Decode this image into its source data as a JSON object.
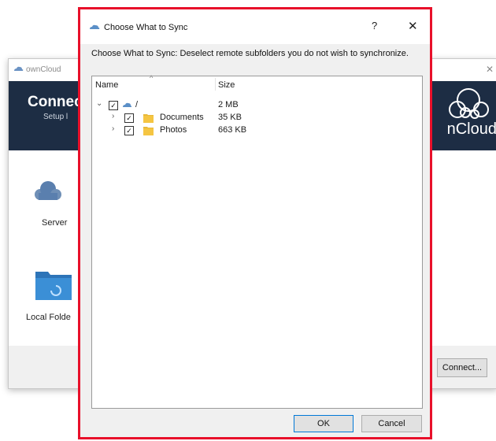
{
  "background_window": {
    "title": "ownCloud",
    "header_title": "Connec",
    "header_subtitle": "Setup l",
    "logo_text": "nCloud",
    "server_label": "Server",
    "local_folder_label": "Local Folde",
    "connect_button": "Connect..."
  },
  "dialog": {
    "title": "Choose What to Sync",
    "help_label": "?",
    "close_label": "✕",
    "description": "Choose What to Sync: Deselect remote subfolders you do not wish to synchronize.",
    "columns": {
      "name": "Name",
      "size": "Size"
    },
    "tree": [
      {
        "name": "/",
        "size": "2 MB",
        "checked": true,
        "expanded": true,
        "level": 0
      },
      {
        "name": "Documents",
        "size": "35 KB",
        "checked": true,
        "expanded": false,
        "level": 1
      },
      {
        "name": "Photos",
        "size": "663 KB",
        "checked": true,
        "expanded": false,
        "level": 1
      }
    ],
    "ok_button": "OK",
    "cancel_button": "Cancel"
  },
  "colors": {
    "highlight_border": "#e8102a",
    "header_bg": "#1d2d44",
    "folder_yellow": "#f5c542",
    "cloud_blue": "#5b8fc7"
  }
}
